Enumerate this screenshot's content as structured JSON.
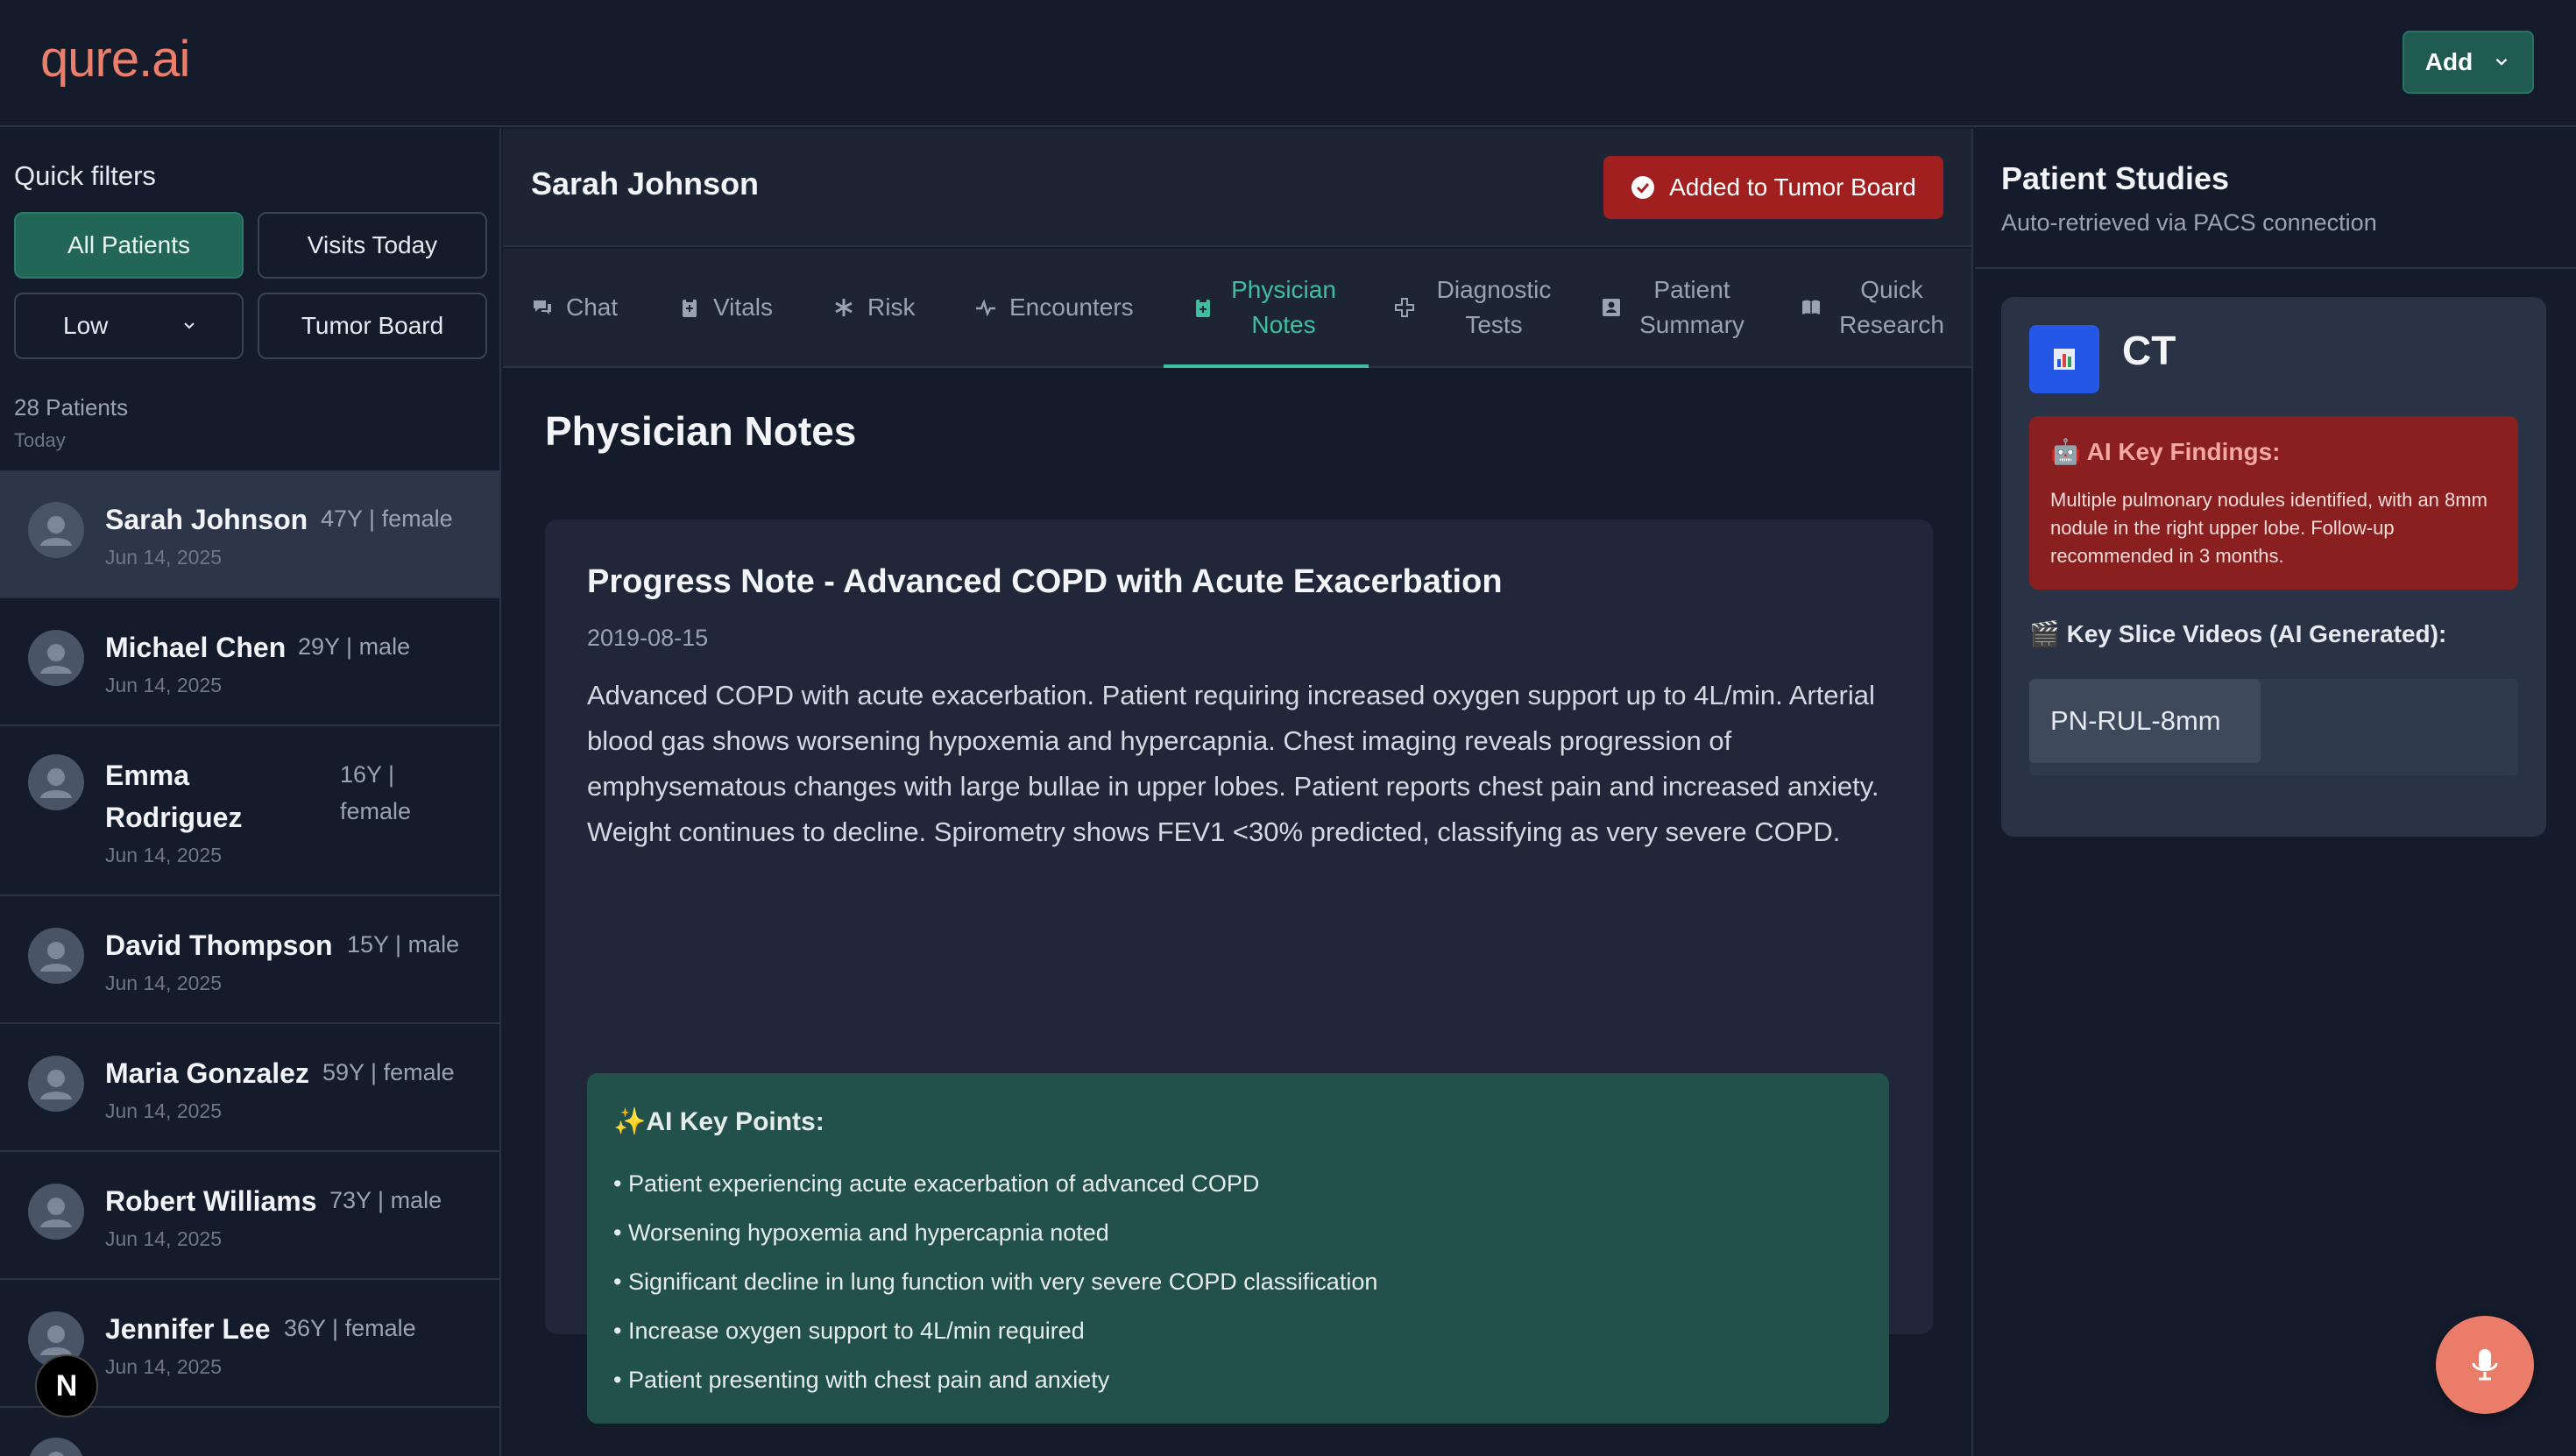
{
  "app": {
    "logo_text": "qure.ai",
    "add_label": "Add"
  },
  "filters": {
    "title": "Quick filters",
    "all_patients": "All Patients",
    "visits_today": "Visits Today",
    "priority_selected": "Low",
    "tumor_board": "Tumor Board",
    "count_label": "28 Patients",
    "count_sub": "Today"
  },
  "patients": [
    {
      "name": "Sarah Johnson",
      "meta": "47Y | female",
      "date": "Jun 14, 2025"
    },
    {
      "name": "Michael Chen",
      "meta": "29Y | male",
      "date": "Jun 14, 2025"
    },
    {
      "name": "Emma Rodriguez",
      "meta": "16Y | female",
      "date": "Jun 14, 2025"
    },
    {
      "name": "David Thompson",
      "meta": "15Y | male",
      "date": "Jun 14, 2025"
    },
    {
      "name": "Maria Gonzalez",
      "meta": "59Y | female",
      "date": "Jun 14, 2025"
    },
    {
      "name": "Robert Williams",
      "meta": "73Y | male",
      "date": "Jun 14, 2025"
    },
    {
      "name": "Jennifer Lee",
      "meta": "36Y | female",
      "date": "Jun 14, 2025"
    }
  ],
  "header": {
    "patient_name": "Sarah Johnson",
    "tumor_board_status": "Added to Tumor Board"
  },
  "tabs": [
    {
      "label": "Chat",
      "icon": "chat-icon"
    },
    {
      "label": "Vitals",
      "icon": "clipboard-icon"
    },
    {
      "label": "Risk",
      "icon": "asterisk-icon"
    },
    {
      "label": "Encounters",
      "icon": "pulse-icon"
    },
    {
      "label": "Physician Notes",
      "icon": "notes-icon",
      "active": true
    },
    {
      "label": "Diagnostic Tests",
      "icon": "cross-icon"
    },
    {
      "label": "Patient Summary",
      "icon": "summary-icon"
    },
    {
      "label": "Quick Research",
      "icon": "book-icon"
    }
  ],
  "notes": {
    "section_title": "Physician Notes",
    "note_title": "Progress Note - Advanced COPD with Acute Exacerbation",
    "note_date": "2019-08-15",
    "note_body": "Advanced COPD with acute exacerbation. Patient requiring increased oxygen support up to 4L/min. Arterial blood gas shows worsening hypoxemia and hypercapnia. Chest imaging reveals progression of emphysematous changes with large bullae in upper lobes. Patient reports chest pain and increased anxiety. Weight continues to decline. Spirometry shows FEV1 <30% predicted, classifying as very severe COPD.",
    "ai_title": "✨AI Key Points:",
    "ai_points": [
      "• Patient experiencing acute exacerbation of advanced COPD",
      "• Worsening hypoxemia and hypercapnia noted",
      "• Significant decline in lung function with very severe COPD classification",
      "• Increase oxygen support to 4L/min required",
      "• Patient presenting with chest pain and anxiety"
    ]
  },
  "studies": {
    "title": "Patient Studies",
    "subtitle": "Auto-retrieved via PACS connection",
    "modality": "CT",
    "findings_title": "🤖 AI Key Findings:",
    "findings_text": "Multiple pulmonary nodules identified, with an 8mm nodule in the right upper lobe. Follow-up recommended in 3 months.",
    "slice_title": "🎬 Key Slice Videos (AI Generated):",
    "slice_tag": "PN-RUL-8mm"
  },
  "colors": {
    "background": "#141b2b",
    "accent_teal": "#216656",
    "tumor_red": "#a11f1f",
    "logo_coral": "#ec7f6b",
    "active_tab": "#3fbf9f"
  }
}
